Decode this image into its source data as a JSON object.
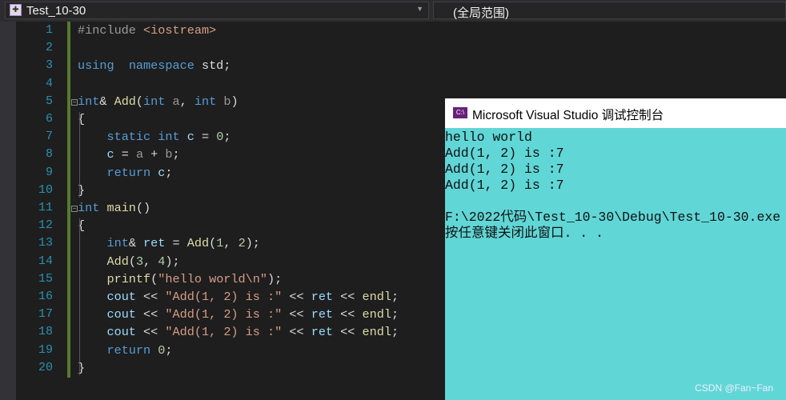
{
  "toolbar": {
    "file_dropdown": "Test_10-30",
    "scope_dropdown": "(全局范围)"
  },
  "editor": {
    "lines": [
      [
        [
          "pp",
          "#include "
        ],
        [
          "inc",
          "<iostream>"
        ]
      ],
      [],
      [
        [
          "k",
          "using"
        ],
        [
          "",
          "  "
        ],
        [
          "k",
          "namespace"
        ],
        [
          "",
          " std;"
        ]
      ],
      [],
      [
        [
          "k",
          "int"
        ],
        [
          "",
          "& "
        ],
        [
          "f",
          "Add"
        ],
        [
          "",
          "("
        ],
        [
          "k",
          "int"
        ],
        [
          "",
          " "
        ],
        [
          "p",
          "a"
        ],
        [
          "",
          ", "
        ],
        [
          "k",
          "int"
        ],
        [
          "",
          " "
        ],
        [
          "p",
          "b"
        ],
        [
          "",
          ")"
        ]
      ],
      [
        [
          "",
          "{"
        ]
      ],
      [
        [
          "",
          "    "
        ],
        [
          "k",
          "static"
        ],
        [
          "",
          " "
        ],
        [
          "k",
          "int"
        ],
        [
          "",
          " "
        ],
        [
          "v",
          "c"
        ],
        [
          "",
          " = "
        ],
        [
          "n",
          "0"
        ],
        [
          "",
          ";"
        ]
      ],
      [
        [
          "",
          "    "
        ],
        [
          "v",
          "c"
        ],
        [
          "",
          " = "
        ],
        [
          "p",
          "a"
        ],
        [
          "",
          " + "
        ],
        [
          "p",
          "b"
        ],
        [
          "",
          ";"
        ]
      ],
      [
        [
          "",
          "    "
        ],
        [
          "k",
          "return"
        ],
        [
          "",
          " "
        ],
        [
          "v",
          "c"
        ],
        [
          "",
          ";"
        ]
      ],
      [
        [
          "",
          "}"
        ]
      ],
      [
        [
          "k",
          "int"
        ],
        [
          "",
          " "
        ],
        [
          "f",
          "main"
        ],
        [
          "",
          "()"
        ]
      ],
      [
        [
          "",
          "{"
        ]
      ],
      [
        [
          "",
          "    "
        ],
        [
          "k",
          "int"
        ],
        [
          "",
          "& "
        ],
        [
          "v",
          "ret"
        ],
        [
          "",
          " = "
        ],
        [
          "f",
          "Add"
        ],
        [
          "",
          "("
        ],
        [
          "n",
          "1"
        ],
        [
          "",
          ", "
        ],
        [
          "n",
          "2"
        ],
        [
          "",
          ");"
        ]
      ],
      [
        [
          "",
          "    "
        ],
        [
          "f",
          "Add"
        ],
        [
          "",
          "("
        ],
        [
          "n",
          "3"
        ],
        [
          "",
          ", "
        ],
        [
          "n",
          "4"
        ],
        [
          "",
          ");"
        ]
      ],
      [
        [
          "",
          "    "
        ],
        [
          "f",
          "printf"
        ],
        [
          "",
          "("
        ],
        [
          "s",
          "\"hello world\\n\""
        ],
        [
          "",
          ");"
        ]
      ],
      [
        [
          "",
          "    "
        ],
        [
          "v",
          "cout"
        ],
        [
          "",
          " << "
        ],
        [
          "s",
          "\"Add(1, 2) is :\""
        ],
        [
          "",
          " << "
        ],
        [
          "v",
          "ret"
        ],
        [
          "",
          " << "
        ],
        [
          "f",
          "endl"
        ],
        [
          "",
          ";"
        ]
      ],
      [
        [
          "",
          "    "
        ],
        [
          "v",
          "cout"
        ],
        [
          "",
          " << "
        ],
        [
          "s",
          "\"Add(1, 2) is :\""
        ],
        [
          "",
          " << "
        ],
        [
          "v",
          "ret"
        ],
        [
          "",
          " << "
        ],
        [
          "f",
          "endl"
        ],
        [
          "",
          ";"
        ]
      ],
      [
        [
          "",
          "    "
        ],
        [
          "v",
          "cout"
        ],
        [
          "",
          " << "
        ],
        [
          "s",
          "\"Add(1, 2) is :\""
        ],
        [
          "",
          " << "
        ],
        [
          "v",
          "ret"
        ],
        [
          "",
          " << "
        ],
        [
          "f",
          "endl"
        ],
        [
          "",
          ";"
        ]
      ],
      [
        [
          "",
          "    "
        ],
        [
          "k",
          "return"
        ],
        [
          "",
          " "
        ],
        [
          "n",
          "0"
        ],
        [
          "",
          ";"
        ]
      ],
      [
        [
          "",
          "}"
        ]
      ]
    ]
  },
  "console": {
    "title": "Microsoft Visual Studio 调试控制台",
    "icon_label": "C:\\",
    "output": [
      "hello world",
      "Add(1, 2) is :7",
      "Add(1, 2) is :7",
      "Add(1, 2) is :7",
      "",
      "F:\\2022代码\\Test_10-30\\Debug\\Test_10-30.exe",
      "按任意键关闭此窗口. . ."
    ]
  },
  "watermark": "CSDN @Fan~Fan"
}
